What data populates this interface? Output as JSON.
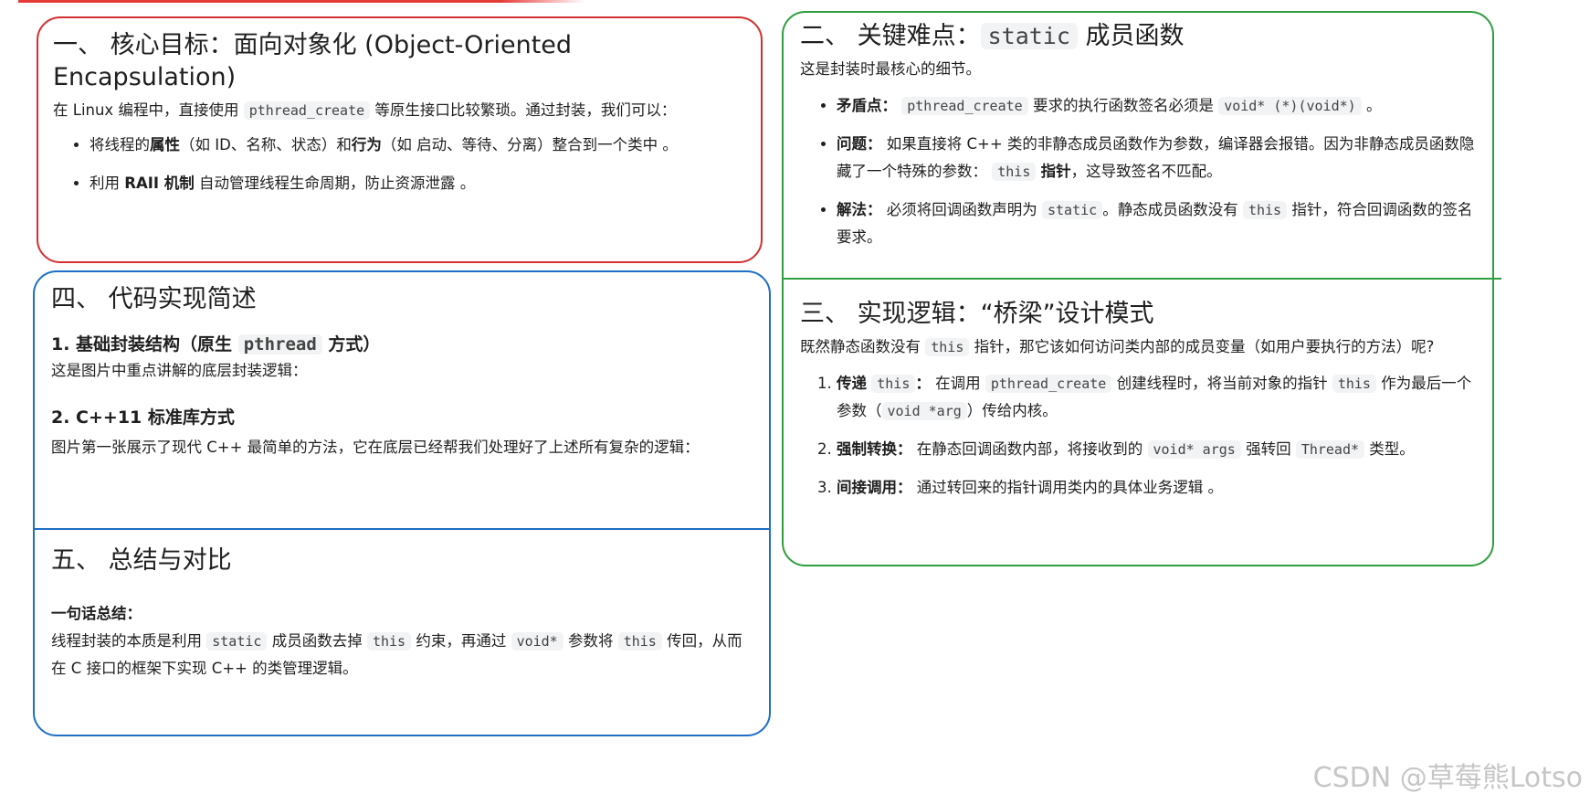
{
  "section1": {
    "title": "一、 核心目标：面向对象化 (Object-Oriented Encapsulation)",
    "intro_a": "在 Linux 编程中，直接使用",
    "intro_code": "pthread_create",
    "intro_b": "等原生接口比较繁琐。通过封装，我们可以：",
    "b1_a": "将线程的",
    "b1_b": "属性",
    "b1_c": "（如 ID、名称、状态）和",
    "b1_d": "行为",
    "b1_e": "（如 启动、等待、分离）整合到一个类中 。",
    "b2_a": "利用",
    "b2_b": "RAII 机制",
    "b2_c": "自动管理线程生命周期，防止资源泄露 。"
  },
  "section4": {
    "title": "四、 代码实现简述",
    "sub1_a": "1. 基础封装结构（原生",
    "sub1_code": "pthread",
    "sub1_b": "方式）",
    "sub1_text": "这是图片中重点讲解的底层封装逻辑：",
    "sub2": "2. C++11 标准库方式",
    "sub2_text": "图片第一张展示了现代 C++ 最简单的方法，它在底层已经帮我们处理好了上述所有复杂的逻辑："
  },
  "section5": {
    "title": "五、 总结与对比",
    "summary_label": "一句话总结：",
    "t_a": "线程封装的本质是利用",
    "t_code1": "static",
    "t_b": "成员函数去掉",
    "t_code2": "this",
    "t_c": "约束，再通过",
    "t_code3": "void*",
    "t_d": "参数将",
    "t_code4": "this",
    "t_e": "传回，从而在 C 接口的框架下实现 C++ 的类管理逻辑。"
  },
  "section2": {
    "title_a": "二、 关键难点：",
    "title_code": "static",
    "title_b": "成员函数",
    "intro": "这是封装时最核心的细节。",
    "b1_label": "矛盾点：",
    "b1_code1": "pthread_create",
    "b1_a": "要求的执行函数签名必须是",
    "b1_code2": "void* (*)(void*)",
    "b1_b": "。",
    "b2_label": "问题：",
    "b2_a": "如果直接将 C++ 类的非静态成员函数作为参数，编译器会报错。因为非静态成员函数隐藏了一个特殊的参数：",
    "b2_code": "this",
    "b2_b": "指针",
    "b2_c": "，这导致签名不匹配。",
    "b3_label": "解法：",
    "b3_a": "必须将回调函数声明为",
    "b3_code1": "static",
    "b3_b": "。静态成员函数没有",
    "b3_code2": "this",
    "b3_c": "指针，符合回调函数的签名要求。"
  },
  "section3": {
    "title": "三、 实现逻辑：“桥梁”设计模式",
    "intro_a": "既然静态函数没有",
    "intro_code": "this",
    "intro_b": "指针，那它该如何访问类内部的成员变量（如用户要执行的方法）呢?",
    "i1_label_a": "传递",
    "i1_label_code": "this",
    "i1_label_b": "：",
    "i1_a": "在调用",
    "i1_code1": "pthread_create",
    "i1_b": "创建线程时，将当前对象的指针",
    "i1_code2": "this",
    "i1_c": "作为最后一个参数（",
    "i1_code3": "void *arg",
    "i1_d": "）传给内核。",
    "i2_label": "强制转换：",
    "i2_a": "在静态回调函数内部，将接收到的",
    "i2_code1": "void* args",
    "i2_b": "强转回",
    "i2_code2": "Thread*",
    "i2_c": "类型。",
    "i3_label": "间接调用：",
    "i3_a": "通过转回来的指针调用类内的具体业务逻辑 。"
  },
  "watermark": "CSDN @草莓熊Lotso",
  "colors": {
    "red": "#d32f2f",
    "blue": "#1e6fc5",
    "green": "#2e9e3e",
    "code_bg": "#f1f3f4"
  }
}
